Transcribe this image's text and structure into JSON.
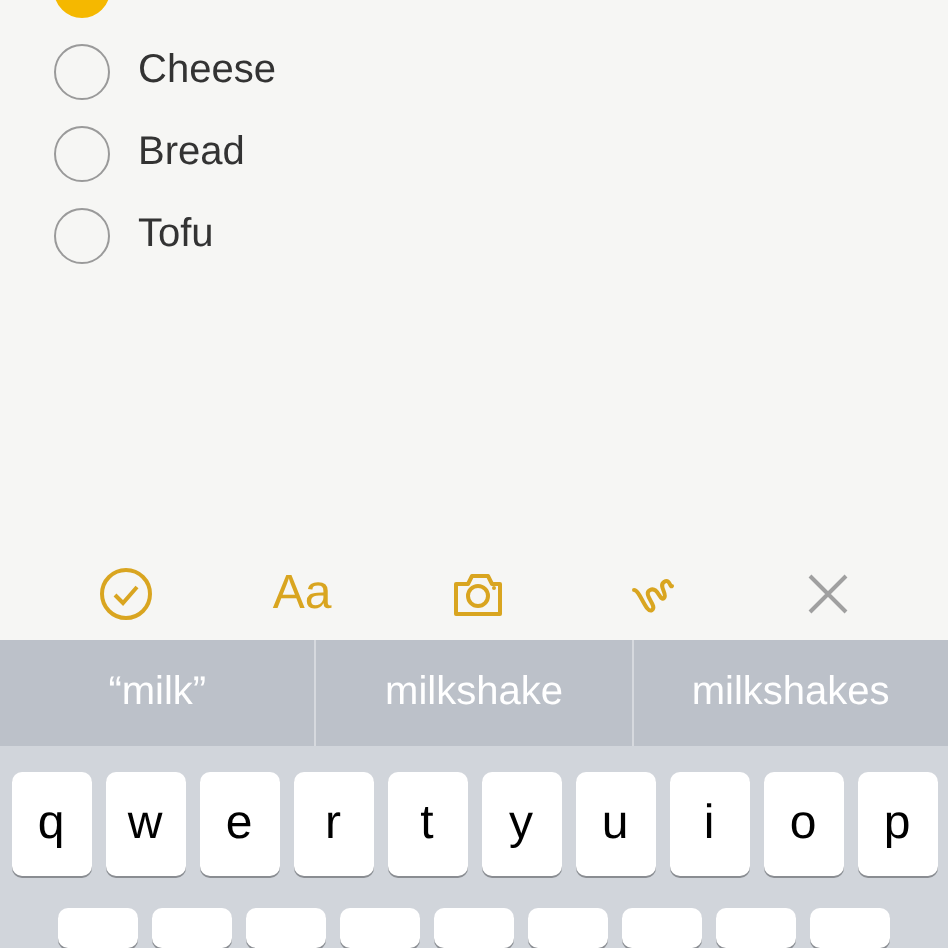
{
  "checklist": [
    {
      "checked": true
    },
    {
      "label": "Cheese",
      "checked": false
    },
    {
      "label": "Bread",
      "checked": false
    },
    {
      "label": "Tofu",
      "checked": false
    }
  ],
  "toolbar": [
    {
      "kind": "checklist"
    },
    {
      "kind": "format",
      "label": "Aa"
    },
    {
      "kind": "camera"
    },
    {
      "kind": "sketch"
    },
    {
      "kind": "close"
    }
  ],
  "suggestions": [
    "“milk”",
    "milkshake",
    "milkshakes"
  ],
  "keyboard": {
    "rows": [
      [
        "q",
        "w",
        "e",
        "r",
        "t",
        "y",
        "u",
        "i",
        "o",
        "p"
      ]
    ]
  }
}
